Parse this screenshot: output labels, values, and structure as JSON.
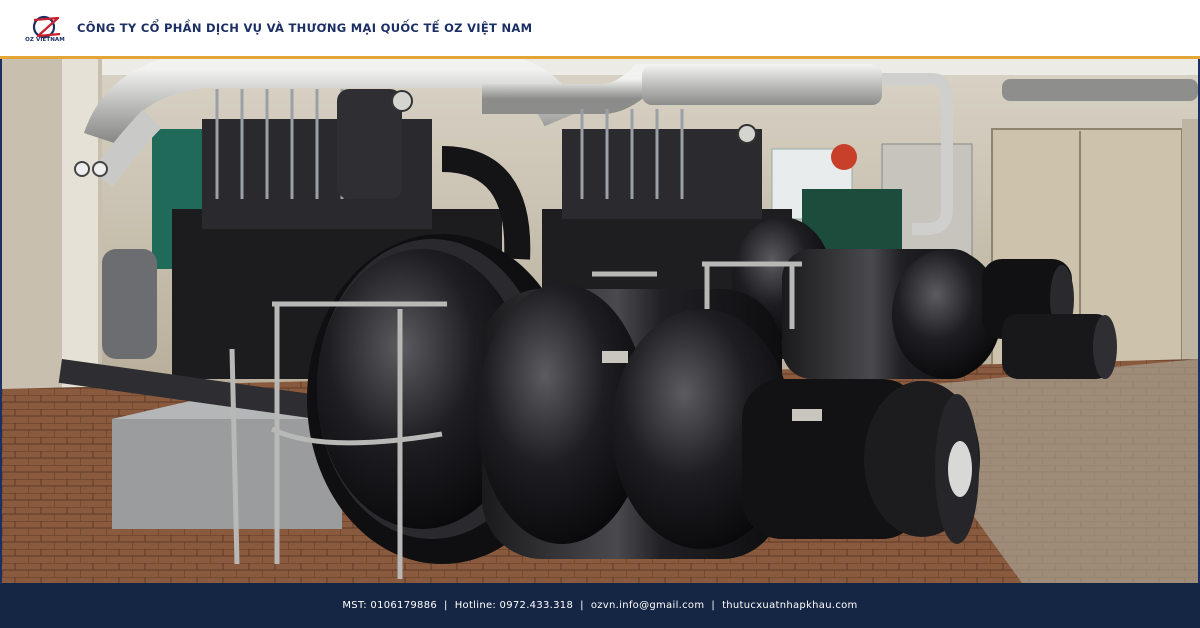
{
  "header": {
    "logo_text": "OZ VIETNAM",
    "company_name": "CÔNG TY CỔ PHẦN DỊCH VỤ VÀ THƯƠNG MẠI QUỐC TẾ OZ VIỆT NAM"
  },
  "photo": {
    "icon": "engine-room-photo"
  },
  "footer": {
    "tax_code": "MST: 0106179886",
    "hotline": "Hotline: 0972.433.318",
    "email": "ozvn.info@gmail.com",
    "website": "thutucxuatnhapkhau.com",
    "separator": "|"
  },
  "colors": {
    "brand_navy": "#1c2f63",
    "accent_gold": "#e3a536",
    "footer_bg": "#152544",
    "logo_red": "#c8202f"
  }
}
